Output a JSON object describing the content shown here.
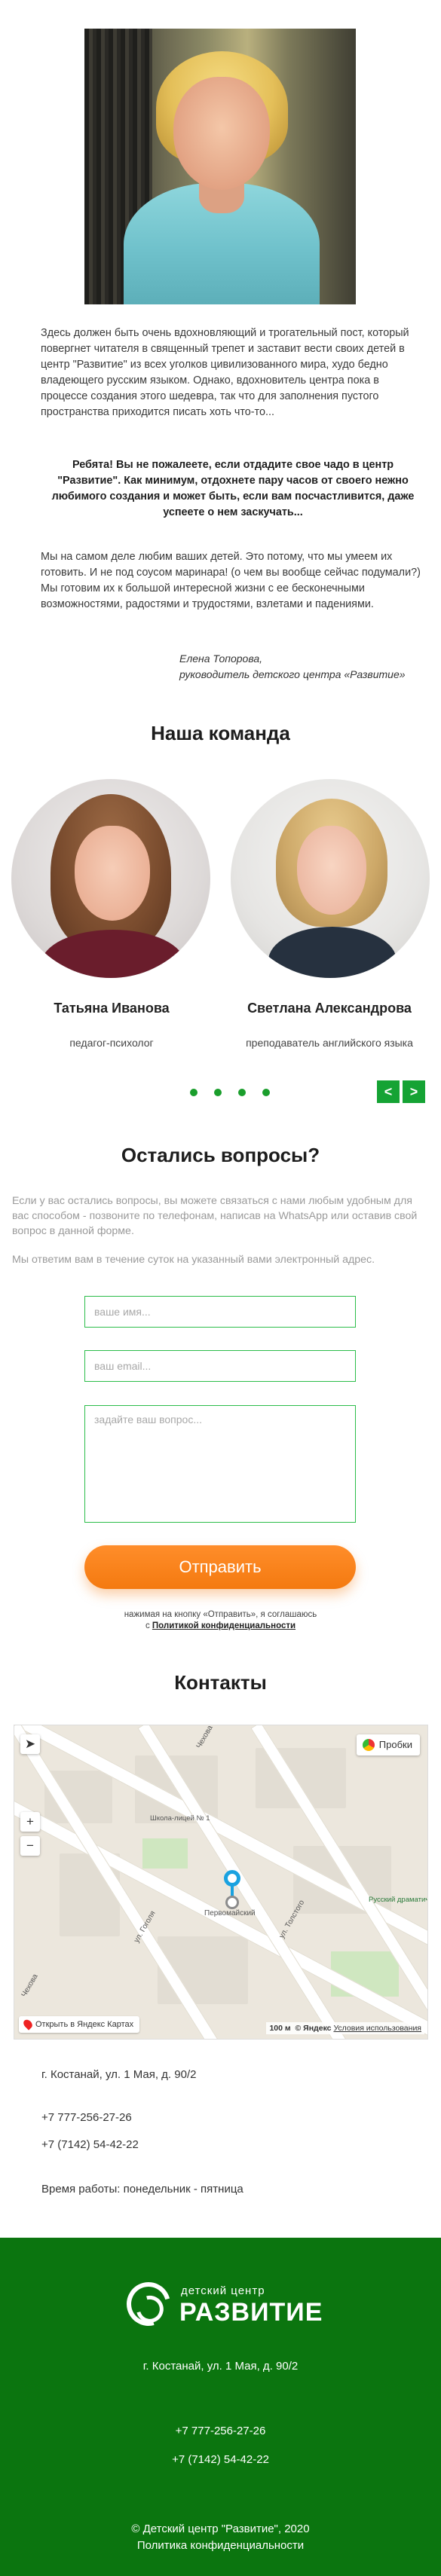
{
  "intro": {
    "paragraph1": "Здесь должен быть очень вдохновляющий и трогательный пост, который повергнет читателя в священный трепет и заставит вести своих детей в центр \"Развитие\" из всех уголков цивилизованного мира, худо бедно владеющего русским языком. Однако, вдохновитель центра пока в процессе создания этого шедевра, так что для заполнения пустого пространства приходится писать хоть что-то...",
    "paragraph2": "Ребята! Вы не пожалеете, если отдадите свое чадо в центр \"Развитие\". Как минимум, отдохнете пару часов от своего нежно любимого создания и может быть, если вам посчастливится, даже успеете о нем заскучать...",
    "paragraph3": "Мы на самом деле любим ваших детей. Это потому, что мы умеем их готовить. И не под соусом маринара! (о чем вы вообще сейчас подумали?) Мы готовим их к большой интересной жизни с ее бесконечными возможностями, радостями и трудостями, взлетами и падениями.",
    "signature_name": "Елена Топорова,",
    "signature_role": "руководитель детского центра «Развитие»"
  },
  "team": {
    "title": "Наша команда",
    "members": [
      {
        "name": "Татьяна Иванова",
        "role": "педагог-психолог"
      },
      {
        "name": "Светлана Александрова",
        "role": "преподаватель английского языка"
      }
    ],
    "prev_arrow": "<",
    "next_arrow": ">"
  },
  "questions": {
    "title": "Остались вопросы?",
    "text1": "Если у вас остались вопросы, вы можете связаться с нами любым удобным для вас способом - позвоните по телефонам, написав на WhatsApp или оставив свой вопрос в данной форме.",
    "text2": "Мы ответим вам в течение суток на указанный вами электронный адрес.",
    "name_placeholder": "ваше имя...",
    "email_placeholder": "ваш email...",
    "question_placeholder": "задайте ваш вопрос...",
    "submit_label": "Отправить",
    "consent_text": "нажимая на кнопку «Отправить», я соглашаюсь",
    "consent_prefix": "с",
    "consent_link": "Политикой конфиденциальности"
  },
  "contacts": {
    "title": "Контакты",
    "map": {
      "traffic_label": "Пробки",
      "zoom_in": "+",
      "zoom_out": "−",
      "open_label": "Открыть в Яндекс Картах",
      "scale": "100 м",
      "copyright": "© Яндекс",
      "terms": "Условия использования",
      "poi_school": "Школа-лицей № 1",
      "poi_pervomaisky": "Первомайский",
      "poi_theatre": "Русский драматический те",
      "street_gogol": "ул. Гоголя",
      "street_tolstogo": "ул. Толстого",
      "street_chekhova": "Чехова",
      "street_chekhova2": "Чехова"
    },
    "address": "г. Костанай, ул. 1 Мая, д. 90/2",
    "phone1": "+7 777-256-27-26",
    "phone2": "+7 (7142) 54-42-22",
    "hours": "Время работы: понедельник - пятница"
  },
  "footer": {
    "logo_sub": "детский центр",
    "logo_main": "РАЗВИТИЕ",
    "address": "г. Костанай, ул. 1 Мая, д. 90/2",
    "phone1": "+7 777-256-27-26",
    "phone2": "+7 (7142) 54-42-22",
    "copyright": "© Детский центр \"Развитие\", 2020",
    "policy_link": "Политика конфиденциальности"
  },
  "colors": {
    "accent_green": "#15a334",
    "footer_green": "#0b750f",
    "button_orange": "#f47a10"
  }
}
